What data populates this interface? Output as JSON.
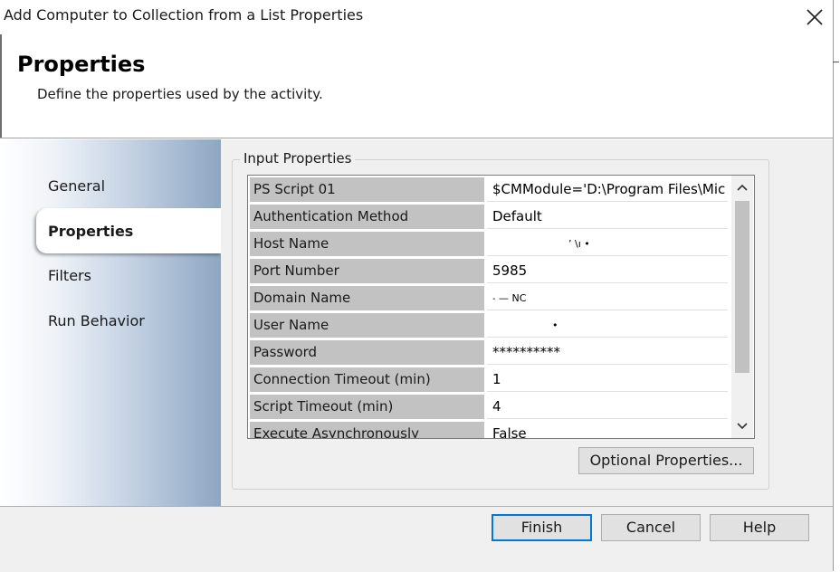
{
  "window": {
    "title": "Add Computer to Collection from a List Properties",
    "close_icon": "close-icon"
  },
  "header": {
    "title": "Properties",
    "subtitle": "Define the properties used by the activity."
  },
  "sidebar": {
    "items": [
      {
        "label": "General",
        "selected": false
      },
      {
        "label": "Properties",
        "selected": true
      },
      {
        "label": "Filters",
        "selected": false
      },
      {
        "label": "Run Behavior",
        "selected": false
      }
    ]
  },
  "input_properties": {
    "group_title": "Input Properties",
    "rows": [
      {
        "key": "PS Script 01",
        "value": "$CMModule='D:\\Program Files\\Mic"
      },
      {
        "key": "Authentication Method",
        "value": "Default"
      },
      {
        "key": "Host Name",
        "value": "ʼ \\ı •"
      },
      {
        "key": "Port Number",
        "value": "5985"
      },
      {
        "key": "Domain Name",
        "value": "˗ — NC"
      },
      {
        "key": "User Name",
        "value": "•"
      },
      {
        "key": "Password",
        "value": "**********"
      },
      {
        "key": "Connection Timeout (min)",
        "value": "1"
      },
      {
        "key": "Script Timeout (min)",
        "value": "4"
      },
      {
        "key": "Execute Asynchronously",
        "value": "False"
      }
    ],
    "scroll_up_icon": "chevron-up-icon",
    "scroll_down_icon": "chevron-down-icon"
  },
  "buttons": {
    "optional_properties": "Optional Properties...",
    "finish": "Finish",
    "cancel": "Cancel",
    "help": "Help"
  },
  "colors": {
    "default_button_border": "#0078d7",
    "key_cell_bg": "#c2c2c2"
  }
}
